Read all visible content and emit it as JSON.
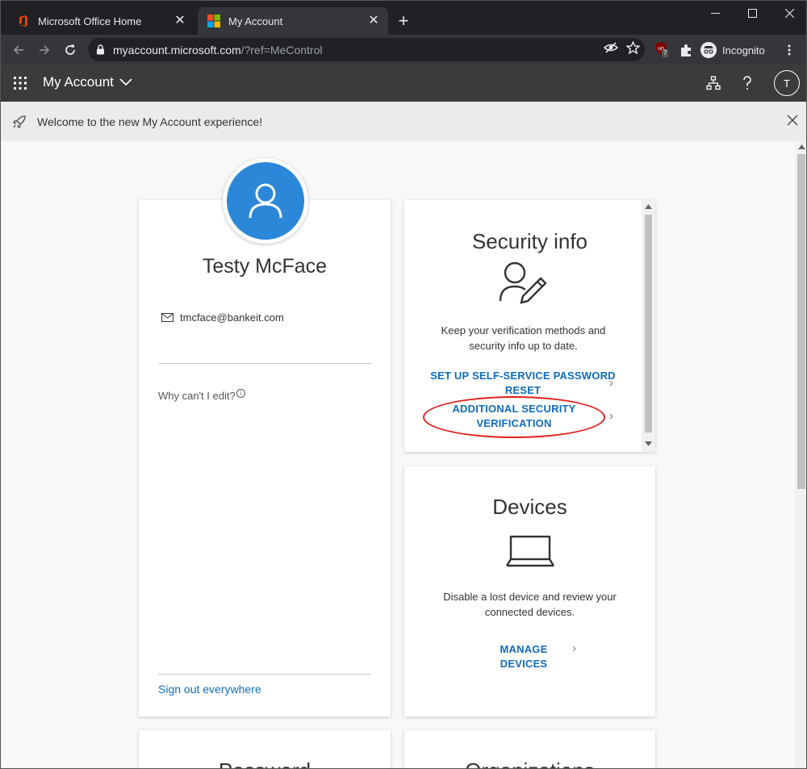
{
  "browser": {
    "tabs": [
      {
        "title": "Microsoft Office Home",
        "active": false
      },
      {
        "title": "My Account",
        "active": true
      }
    ],
    "url_host": "myaccount.microsoft.com",
    "url_rest": "/?ref=MeControl",
    "incognito_label": "Incognito",
    "extension_badge": "7"
  },
  "appbar": {
    "title": "My Account",
    "avatar_initial": "T"
  },
  "banner": {
    "text": "Welcome to the new My Account experience!"
  },
  "profile": {
    "name": "Testy McFace",
    "email": "tmcface@bankeit.com",
    "why_label": "Why can't I edit?",
    "info_glyph": "i",
    "signout_label": "Sign out everywhere"
  },
  "security": {
    "title": "Security info",
    "desc_line1": "Keep your verification methods and",
    "desc_line2": "security info up to date.",
    "link1_line1": "SET UP SELF-SERVICE PASSWORD",
    "link1_line2": "RESET",
    "link2_line1": "ADDITIONAL SECURITY",
    "link2_line2": "VERIFICATION"
  },
  "devices": {
    "title": "Devices",
    "desc_line1": "Disable a lost device and review your",
    "desc_line2": "connected devices.",
    "link": "MANAGE DEVICES"
  },
  "password_card": {
    "title": "Password"
  },
  "org_card": {
    "title": "Organizations"
  },
  "colors": {
    "accent": "#0f6cbd",
    "avatar_blue": "#2b88d8",
    "highlight_red": "#e0201c"
  }
}
